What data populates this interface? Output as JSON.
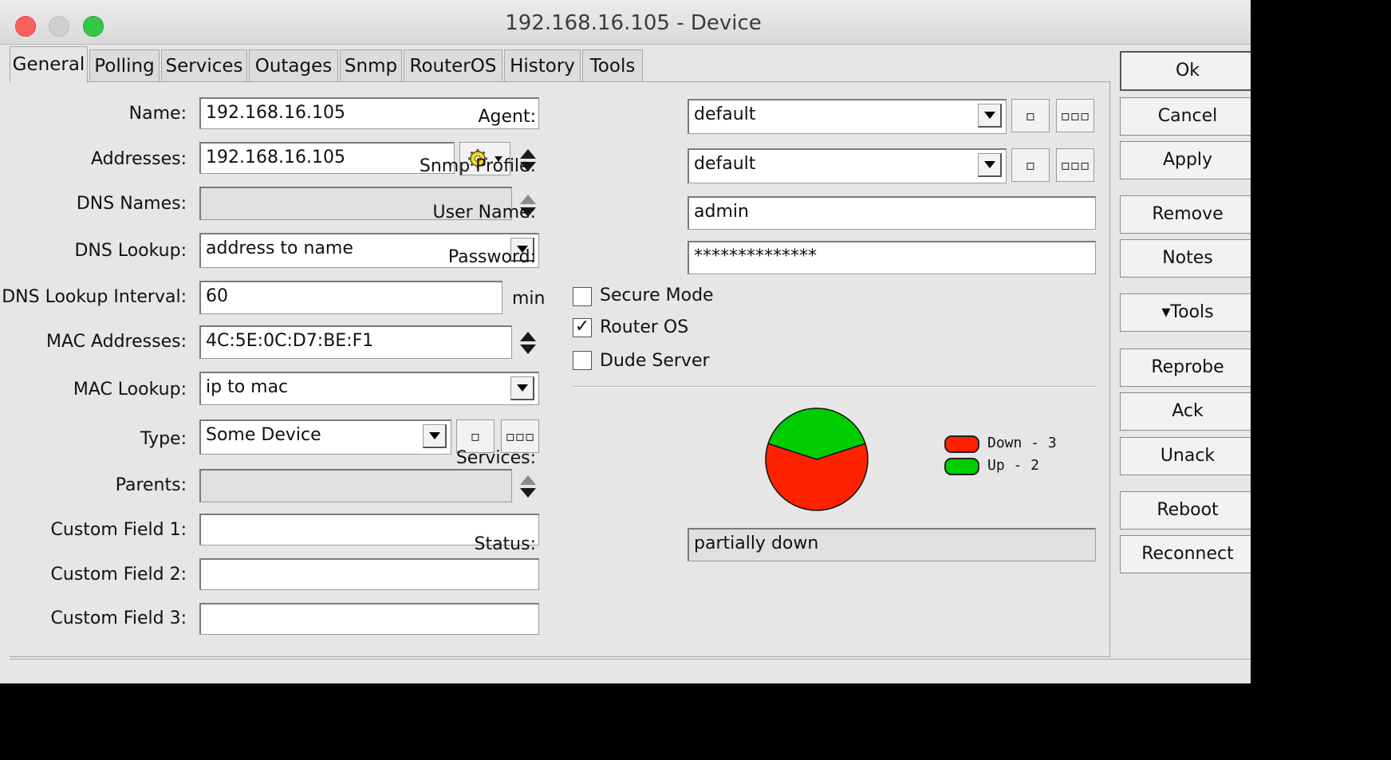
{
  "window": {
    "title": "192.168.16.105 - Device"
  },
  "tabs": [
    "General",
    "Polling",
    "Services",
    "Outages",
    "Snmp",
    "RouterOS",
    "History",
    "Tools"
  ],
  "left": {
    "name": {
      "label": "Name:",
      "value": "192.168.16.105"
    },
    "addresses": {
      "label": "Addresses:",
      "value": "192.168.16.105"
    },
    "dns_names": {
      "label": "DNS Names:",
      "value": ""
    },
    "dns_lookup": {
      "label": "DNS Lookup:",
      "value": "address to name"
    },
    "dns_lookup_interval": {
      "label": "DNS Lookup Interval:",
      "value": "60",
      "unit": "min"
    },
    "mac_addresses": {
      "label": "MAC Addresses:",
      "value": "4C:5E:0C:D7:BE:F1"
    },
    "mac_lookup": {
      "label": "MAC Lookup:",
      "value": "ip to mac"
    },
    "type": {
      "label": "Type:",
      "value": "Some Device"
    },
    "parents": {
      "label": "Parents:",
      "value": ""
    },
    "custom1": {
      "label": "Custom Field 1:",
      "value": ""
    },
    "custom2": {
      "label": "Custom Field 2:",
      "value": ""
    },
    "custom3": {
      "label": "Custom Field 3:",
      "value": ""
    }
  },
  "right": {
    "agent": {
      "label": "Agent:",
      "value": "default"
    },
    "snmp_profile": {
      "label": "Snmp Profile:",
      "value": "default"
    },
    "user_name": {
      "label": "User Name:",
      "value": "admin"
    },
    "password": {
      "label": "Password:",
      "value": "**************"
    },
    "secure_mode": {
      "label": "Secure Mode",
      "checked": false
    },
    "router_os": {
      "label": "Router OS",
      "checked": true
    },
    "dude_server": {
      "label": "Dude Server",
      "checked": false
    },
    "services": {
      "label": "Services:"
    },
    "status": {
      "label": "Status:",
      "value": "partially down"
    }
  },
  "small_button_glyph": "▫",
  "dots_button_glyph": "▫▫▫",
  "check_glyph": "✓",
  "chart_data": {
    "type": "pie",
    "categories": [
      "Down",
      "Up"
    ],
    "values": [
      3,
      2
    ],
    "colors": [
      "#ff2200",
      "#00cc00"
    ],
    "legend": [
      {
        "name": "Down",
        "text": "Down - 3"
      },
      {
        "name": "Up",
        "text": "Up - 2"
      }
    ],
    "legend_position": "right"
  },
  "sidebar": {
    "ok": "Ok",
    "cancel": "Cancel",
    "apply": "Apply",
    "remove": "Remove",
    "notes": "Notes",
    "tools": "▾Tools",
    "reprobe": "Reprobe",
    "ack": "Ack",
    "unack": "Unack",
    "reboot": "Reboot",
    "reconnect": "Reconnect"
  }
}
